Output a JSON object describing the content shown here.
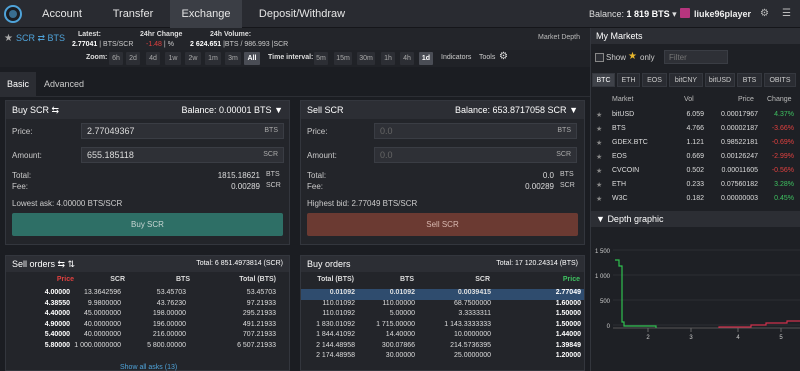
{
  "nav": {
    "items": [
      "Account",
      "Transfer",
      "Exchange",
      "Deposit/Withdraw"
    ],
    "balance_label": "Balance:",
    "balance_value": "1 819 BTS",
    "username": "liuke96player"
  },
  "pair": {
    "label": "SCR ⇄ BTS",
    "latest_label": "Latest:",
    "latest_value": "2.77041",
    "latest_unit": "BTS/SCR",
    "change_label": "24hr Change",
    "change_value": "-1.48",
    "change_unit": "%",
    "volume_label": "24h Volume:",
    "volume_scr": "2 624.651",
    "volume_bts": "BTS / 986.993",
    "volume_unit": "SCR",
    "market_depth": "Market Depth"
  },
  "zoom": {
    "label": "Zoom:",
    "options": [
      "6h",
      "2d",
      "4d",
      "1w",
      "2w",
      "1m",
      "3m",
      "All"
    ],
    "selected": "All",
    "interval_label": "Time interval:",
    "intervals": [
      "5m",
      "15m",
      "30m",
      "1h",
      "4h",
      "1d"
    ],
    "interval_selected": "1d",
    "indicators": "Indicators",
    "tools": "Tools"
  },
  "tabs": [
    "Basic",
    "Advanced"
  ],
  "buy": {
    "title": "Buy SCR ⇆",
    "balance": "Balance: 0.00001 BTS",
    "price_label": "Price:",
    "price_value": "2.77049367",
    "price_unit": "BTS",
    "amount_label": "Amount:",
    "amount_value": "655.185118",
    "amount_unit": "SCR",
    "total_label": "Total:",
    "total_value": "1815.18621",
    "total_unit": "BTS",
    "fee_label": "Fee:",
    "fee_value": "0.00289",
    "fee_unit": "SCR",
    "lowest_ask": "Lowest ask:  4.00000 BTS/SCR",
    "button": "Buy SCR"
  },
  "sell": {
    "title": "Sell SCR",
    "balance": "Balance: 653.8717058 SCR",
    "price_label": "Price:",
    "price_value": "0.0",
    "price_unit": "BTS",
    "amount_label": "Amount:",
    "amount_value": "0.0",
    "amount_unit": "SCR",
    "total_label": "Total:",
    "total_value": "0.0",
    "total_unit": "BTS",
    "fee_label": "Fee:",
    "fee_value": "0.00289",
    "fee_unit": "SCR",
    "highest_bid": "Highest bid:  2.77049 BTS/SCR",
    "button": "Sell SCR"
  },
  "sell_orders": {
    "title": "Sell orders ⇆ ⇅",
    "total": "Total: 6 851.4973814 (SCR)",
    "cols": [
      "Price",
      "SCR",
      "BTS",
      "Total (BTS)"
    ],
    "rows": [
      [
        "4.00000",
        "13.3642596",
        "53.45703",
        "53.45703"
      ],
      [
        "4.38550",
        "9.9800000",
        "43.76230",
        "97.21933"
      ],
      [
        "4.40000",
        "45.0000000",
        "198.00000",
        "295.21933"
      ],
      [
        "4.90000",
        "40.0000000",
        "196.00000",
        "491.21933"
      ],
      [
        "5.40000",
        "40.0000000",
        "216.00000",
        "707.21933"
      ],
      [
        "5.80000",
        "1 000.0000000",
        "5 800.00000",
        "6 507.21933"
      ]
    ],
    "show_all": "Show all asks (13)"
  },
  "buy_orders": {
    "title": "Buy orders",
    "total": "Total: 17 120.24314 (BTS)",
    "cols": [
      "Total (BTS)",
      "BTS",
      "SCR",
      "Price"
    ],
    "rows": [
      [
        "0.01092",
        "0.01092",
        "0.0039415",
        "2.77049"
      ],
      [
        "110.01092",
        "110.00000",
        "68.7500000",
        "1.60000"
      ],
      [
        "110.01092",
        "5.00000",
        "3.3333311",
        "1.50000"
      ],
      [
        "1 830.01092",
        "1 715.00000",
        "1 143.3333333",
        "1.50000"
      ],
      [
        "1 844.41092",
        "14.40000",
        "10.0000000",
        "1.44000"
      ],
      [
        "2 144.48958",
        "300.07866",
        "214.5736395",
        "1.39849"
      ],
      [
        "2 174.48958",
        "30.00000",
        "25.0000000",
        "1.20000"
      ]
    ]
  },
  "markets": {
    "title": "My Markets",
    "show_label": "Show",
    "only_label": "only",
    "filter_placeholder": "Filter",
    "tabs": [
      "BTC",
      "ETH",
      "EOS",
      "bitCNY",
      "bitUSD",
      "BTS",
      "OBITS"
    ],
    "selected_tab": "BTC",
    "cols": [
      "Market",
      "Vol",
      "Price",
      "Change"
    ],
    "rows": [
      [
        "bitUSD",
        "6.059",
        "0.00017967",
        "4.37%",
        "up"
      ],
      [
        "BTS",
        "4.766",
        "0.00002187",
        "-3.66%",
        "down"
      ],
      [
        "GDEX.BTC",
        "1.121",
        "0.98522181",
        "-0.69%",
        "down"
      ],
      [
        "EOS",
        "0.669",
        "0.00126247",
        "-2.99%",
        "down"
      ],
      [
        "CVCOIN",
        "0.502",
        "0.00011605",
        "-0.56%",
        "down"
      ],
      [
        "ETH",
        "0.233",
        "0.07560182",
        "3.28%",
        "up"
      ],
      [
        "W3C",
        "0.182",
        "0.00000003",
        "0.45%",
        "up"
      ]
    ]
  },
  "depth": {
    "title": "Depth graphic",
    "y_ticks": [
      "1 500",
      "1 000",
      "500",
      "0"
    ],
    "x_ticks": [
      "2",
      "3",
      "4",
      "5"
    ],
    "colors": {
      "bids": "#2fc04f",
      "asks": "#d0304c"
    }
  }
}
